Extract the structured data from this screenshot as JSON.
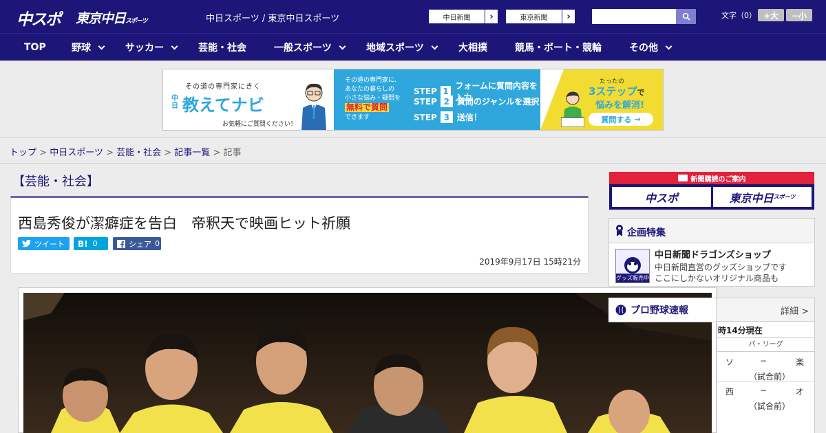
{
  "header": {
    "logo": "中スポ",
    "logo2": "東京中日",
    "logo2_small": "スポーツ",
    "site_title": "中日スポーツ / 東京中日スポーツ",
    "paper1": "中日新聞",
    "paper2": "東京新聞",
    "search_placeholder": "",
    "fontsize_label": "文字（0）",
    "font_up": "+大",
    "font_down": "−小"
  },
  "nav": {
    "items": [
      "TOP",
      "野球",
      "サッカー",
      "芸能・社会",
      "一般スポーツ",
      "地域スポーツ",
      "大相撲",
      "競馬・ボート・競輪",
      "その他"
    ]
  },
  "banner": {
    "tagline": "その道の専門家にきく",
    "brand_small": "中日",
    "brand": "教えてナビ",
    "caption": "お気軽にご質問ください！",
    "mid_line1": "その道の専門家に、",
    "mid_line2": "あなたの暮らしの",
    "mid_line3": "小さな悩み・疑問を",
    "mid_highlight": "無料で質問",
    "mid_line4": "できます",
    "step_word": "STEP",
    "step1_num": "1",
    "step1": "フォームに質問内容を入力",
    "step2_num": "2",
    "step2": "質問のジャンルを選択",
    "step3_num": "3",
    "step3": "送信！",
    "right_small": "たったの",
    "right_big": "3ステップ",
    "right_suffix": "で",
    "right_line2": "悩みを解消!",
    "right_btn": "質問する"
  },
  "breadcrumb": {
    "items": [
      "トップ",
      "中日スポーツ",
      "芸能・社会",
      "記事一覧",
      "記事"
    ],
    "sep": " > "
  },
  "article": {
    "category": "【芸能・社会】",
    "title": "西島秀俊が潔癖症を告白　帝釈天で映画ヒット祈願",
    "tweet": "ツイート",
    "hatena": "B!",
    "hatena_count": "0",
    "share": "シェア",
    "share_count": "0",
    "date": "2019年9月17日 15時21分"
  },
  "sidebar": {
    "subscribe": "新聞購読のご案内",
    "sub_logo1": "中スポ",
    "sub_logo2": "東京中日",
    "sub_logo2_small": "スポーツ",
    "feature_head": "企画特集",
    "feature_title": "中日新聞ドラゴンズショップ",
    "feature_desc1": "中日新聞直営のグッズショップです",
    "feature_desc2": "ここにしかないオリジナル商品も",
    "feature_img_label": "グッズ販売中",
    "score_head": "プロ野球速報",
    "score_more": "詳細 >",
    "score_time": "時14分現在",
    "league": "パ・リーグ",
    "games": [
      {
        "home": "ソ",
        "dash": "−",
        "away": "楽",
        "status": "（試合前）"
      },
      {
        "home": "西",
        "dash": "−",
        "away": "オ",
        "status": "（試合前）"
      }
    ]
  },
  "colors": {
    "navy": "#1b1678",
    "accent": "#e2213a",
    "twitter": "#1da1f2",
    "hatena": "#00a4de",
    "facebook": "#3b5998"
  }
}
